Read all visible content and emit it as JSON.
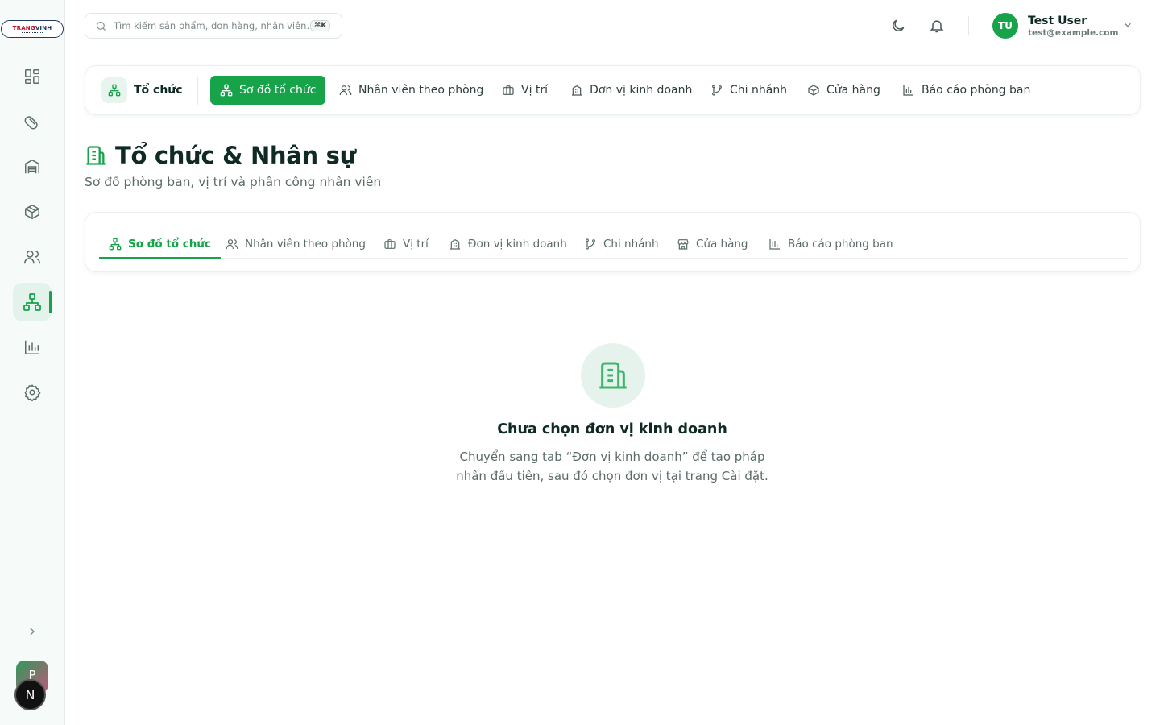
{
  "brand": {
    "name_left": "TRANG",
    "name_right": "VINH"
  },
  "sidebar": {
    "items": [
      {
        "name": "dashboard",
        "icon": "grid-icon"
      },
      {
        "name": "pharmacy",
        "icon": "pill-icon"
      },
      {
        "name": "warehouse",
        "icon": "warehouse-icon"
      },
      {
        "name": "products",
        "icon": "box-icon"
      },
      {
        "name": "customers",
        "icon": "users-icon"
      },
      {
        "name": "organization",
        "icon": "org-chart-icon",
        "active": true
      },
      {
        "name": "reports",
        "icon": "bar-chart-icon"
      },
      {
        "name": "settings",
        "icon": "gear-icon"
      }
    ],
    "project_initial": "P",
    "n_badge": "N"
  },
  "header": {
    "search_placeholder": "Tìm kiếm sản phẩm, đơn hàng, nhân viên...",
    "shortcut": "⌘K",
    "user": {
      "initials": "TU",
      "name": "Test User",
      "email": "test@example.com"
    }
  },
  "topbar": {
    "home_label": "Tổ chức",
    "tabs": [
      {
        "label": "Sơ đồ tổ chức",
        "active": true
      },
      {
        "label": "Nhân viên theo phòng"
      },
      {
        "label": "Vị trí"
      },
      {
        "label": "Đơn vị kinh doanh"
      },
      {
        "label": "Chi nhánh"
      },
      {
        "label": "Cửa hàng"
      },
      {
        "label": "Báo cáo phòng ban"
      }
    ]
  },
  "page": {
    "title": "Tổ chức & Nhân sự",
    "subtitle": "Sơ đồ phòng ban, vị trí và phân công nhân viên"
  },
  "inner_tabs": [
    {
      "label": "Sơ đồ tổ chức",
      "active": true
    },
    {
      "label": "Nhân viên theo phòng"
    },
    {
      "label": "Vị trí"
    },
    {
      "label": "Đơn vị kinh doanh"
    },
    {
      "label": "Chi nhánh"
    },
    {
      "label": "Cửa hàng"
    },
    {
      "label": "Báo cáo phòng ban"
    }
  ],
  "empty_state": {
    "title": "Chưa chọn đơn vị kinh doanh",
    "description": "Chuyển sang tab “Đơn vị kinh doanh” để tạo pháp nhân đầu tiên, sau đó chọn đơn vị tại trang Cài đặt."
  },
  "colors": {
    "accent": "#16a34a",
    "accent_soft": "#e3f2ea",
    "text": "#0f2a24",
    "muted": "#5b6b66"
  }
}
